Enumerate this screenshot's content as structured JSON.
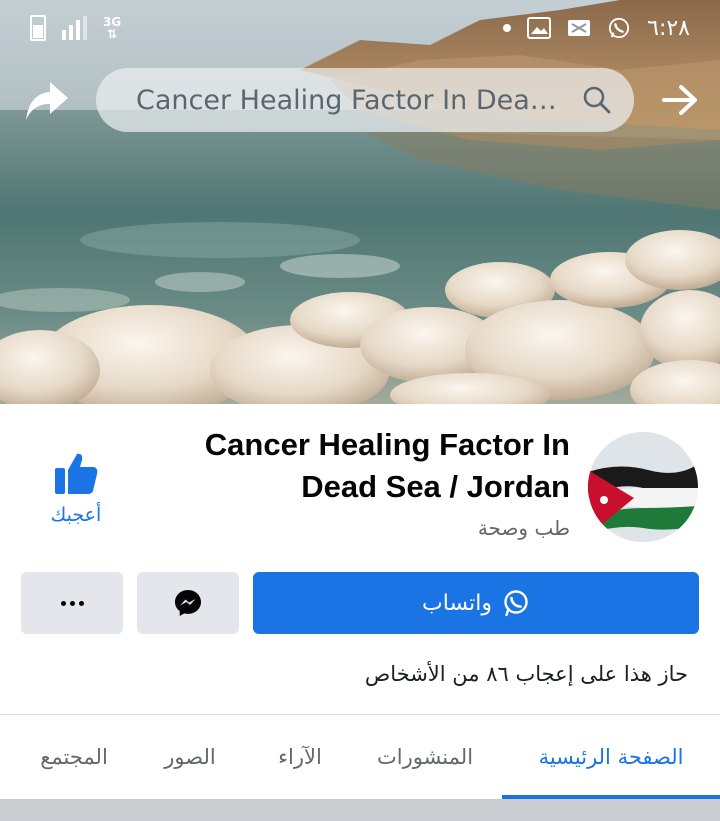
{
  "status_bar": {
    "network_label": "3G",
    "time": "٦:٢٨"
  },
  "search": {
    "query": "Cancer Healing Factor In Dead..."
  },
  "page": {
    "name": "Cancer Healing Factor In Dead Sea / Jordan",
    "category": "طب وصحة",
    "like_label": "أعجبك",
    "likes_summary": "حاز هذا على إعجاب ٨٦ من الأشخاص"
  },
  "actions": {
    "whatsapp_label": "واتساب",
    "messenger_icon": "messenger-icon",
    "more_icon": "more-dots-icon"
  },
  "tabs": [
    {
      "label": "الصفحة الرئيسية",
      "active": true
    },
    {
      "label": "المنشورات",
      "active": false
    },
    {
      "label": "الآراء",
      "active": false
    },
    {
      "label": "الصور",
      "active": false
    },
    {
      "label": "المجتمع",
      "active": false
    }
  ],
  "colors": {
    "accent": "#1b74e4",
    "button_gray": "#e4e6eb",
    "text_secondary": "#65676b"
  }
}
